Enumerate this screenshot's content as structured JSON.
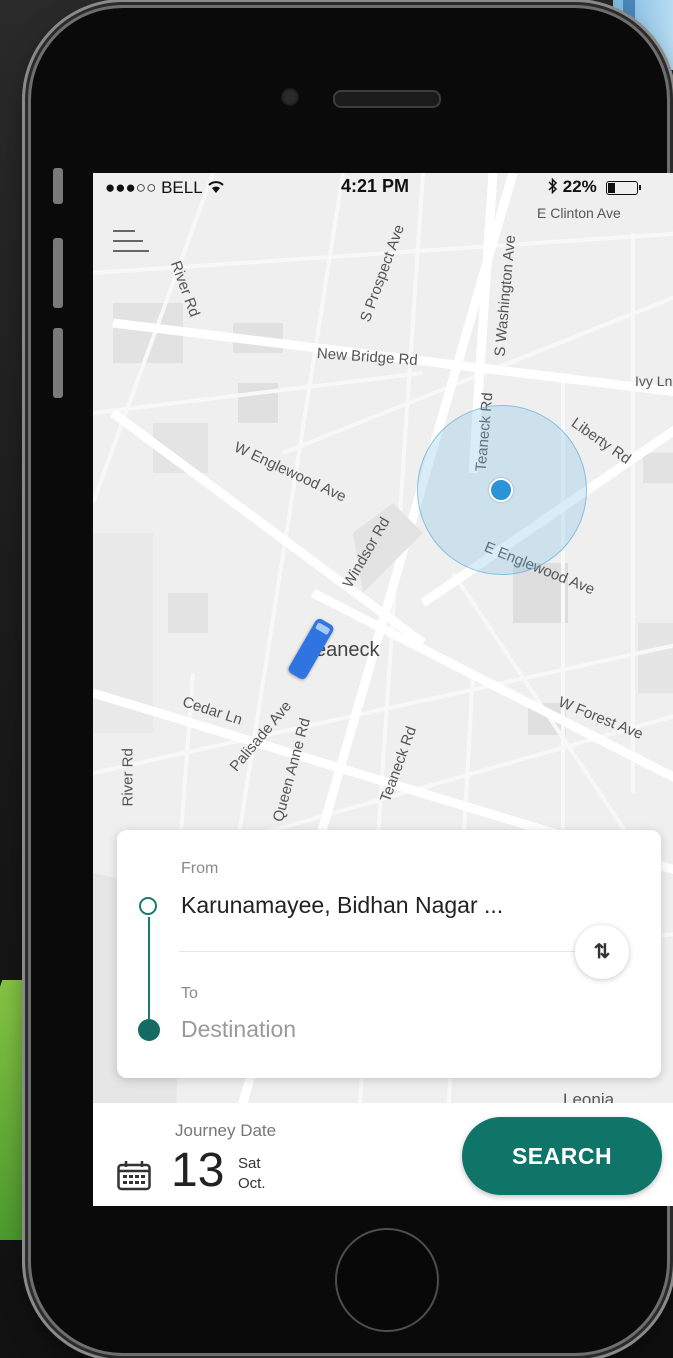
{
  "status_bar": {
    "carrier": "●●●○○ BELL",
    "wifi_icon": "wifi-icon",
    "time": "4:21 PM",
    "bluetooth_icon": "bluetooth-icon",
    "battery": "22%"
  },
  "map": {
    "streets": {
      "e_clinton": "E Clinton Ave",
      "s_prospect": "S Prospect Ave",
      "s_washington": "S Washington Ave",
      "river_rd_top": "River Rd",
      "new_bridge": "New Bridge Rd",
      "ivy_ln": "Ivy Ln",
      "liberty": "Liberty Rd",
      "teaneck_rd_top": "Teaneck Rd",
      "w_englewood": "W Englewood Ave",
      "windsor": "Windsor Rd",
      "e_englewood": "E Englewood Ave",
      "town": "Teaneck",
      "cedar": "Cedar Ln",
      "palisade": "Palisade Ave",
      "queen_anne": "Queen Anne Rd",
      "teaneck_rd_bottom": "Teaneck Rd",
      "w_forest": "W Forest Ave",
      "river_rd_bottom": "River Rd",
      "leonia": "Leonia"
    }
  },
  "route": {
    "from_label": "From",
    "from_value": "Karunamayee, Bidhan Nagar ...",
    "to_label": "To",
    "to_placeholder": "Destination",
    "swap_icon": "swap-icon"
  },
  "journey": {
    "label": "Journey Date",
    "day": "13",
    "weekday": "Sat",
    "month": "Oct.",
    "calendar_icon": "calendar-icon"
  },
  "search_button": "SEARCH",
  "colors": {
    "accent": "#0f7568",
    "location": "#2b93d8",
    "bus": "#2f74e0"
  }
}
